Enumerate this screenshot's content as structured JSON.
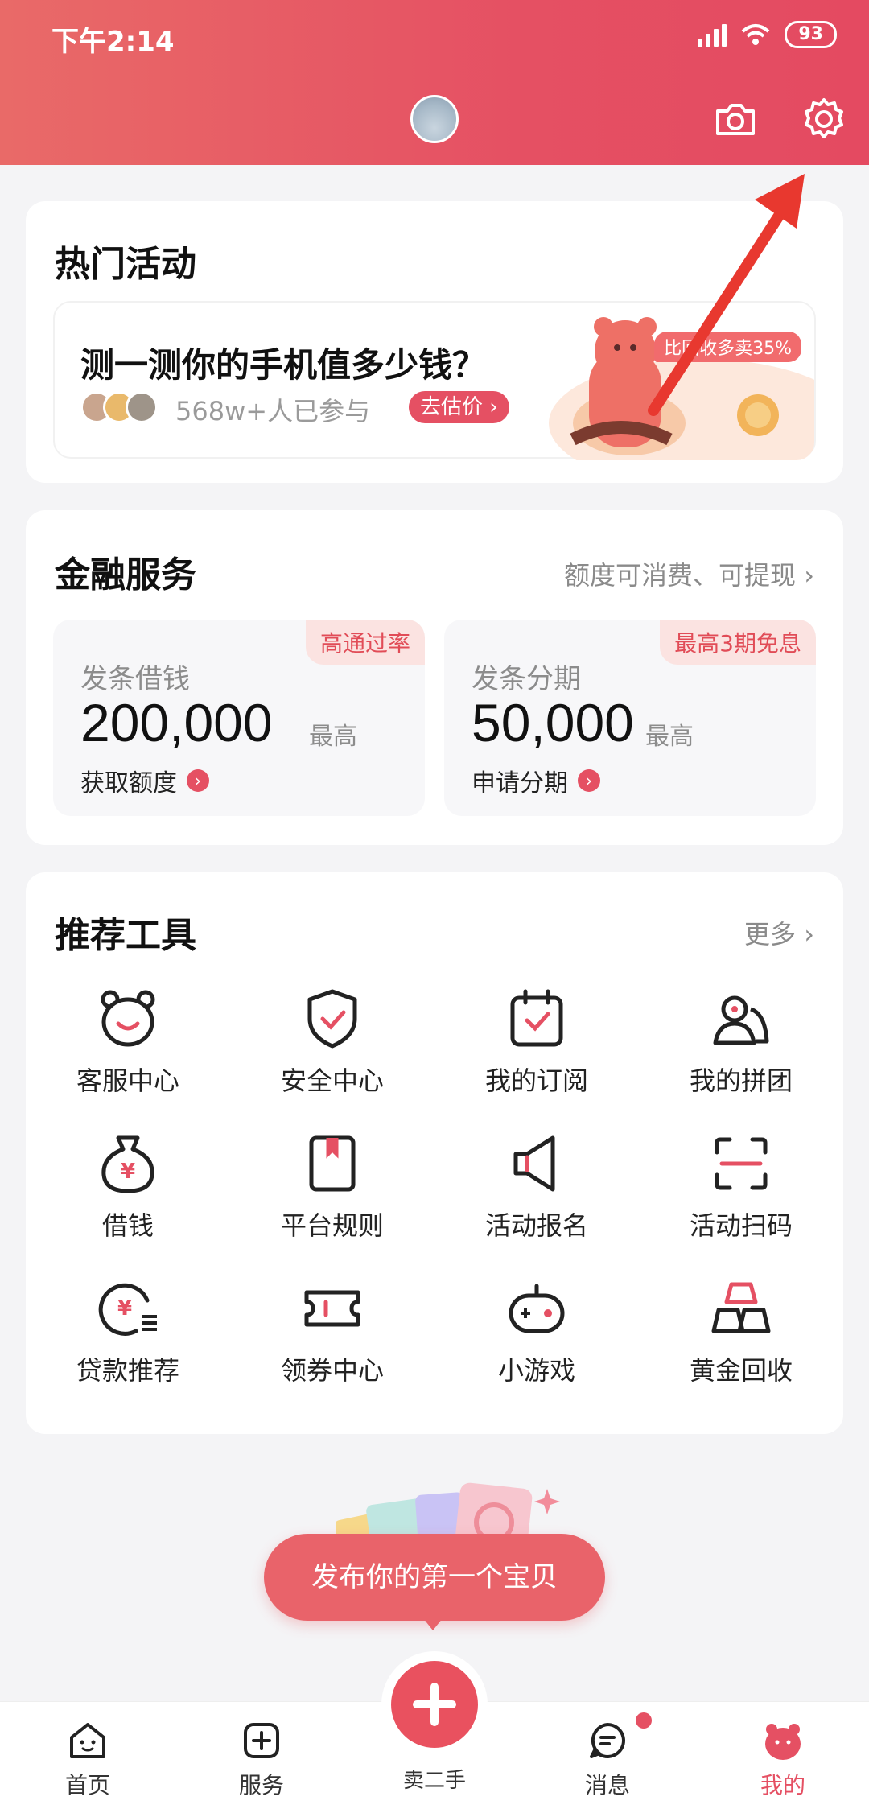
{
  "status_bar": {
    "time": "下午2:14",
    "battery": "93"
  },
  "header": {
    "camera_icon": "camera-icon",
    "settings_icon": "gear-icon"
  },
  "hot": {
    "title": "热门活动",
    "banner_title": "测一测你的手机值多少钱？",
    "participants": "568w+人已参与",
    "button": "去估价",
    "tag": "比回收多卖35%"
  },
  "finance": {
    "title": "金融服务",
    "more": "额度可消费、可提现",
    "cards": [
      {
        "badge": "高通过率",
        "label": "发条借钱",
        "amount": "200,000",
        "unit": "最高",
        "link": "获取额度"
      },
      {
        "badge": "最高3期免息",
        "label": "发条分期",
        "amount": "50,000",
        "unit": "最高",
        "link": "申请分期"
      }
    ]
  },
  "tools": {
    "title": "推荐工具",
    "more": "更多",
    "items": [
      {
        "label": "客服中心",
        "icon": "bear-face-icon"
      },
      {
        "label": "安全中心",
        "icon": "shield-icon"
      },
      {
        "label": "我的订阅",
        "icon": "calendar-icon"
      },
      {
        "label": "我的拼团",
        "icon": "group-icon"
      },
      {
        "label": "借钱",
        "icon": "money-bag-icon"
      },
      {
        "label": "平台规则",
        "icon": "rulebook-icon"
      },
      {
        "label": "活动报名",
        "icon": "megaphone-icon"
      },
      {
        "label": "活动扫码",
        "icon": "scan-icon"
      },
      {
        "label": "贷款推荐",
        "icon": "loan-icon"
      },
      {
        "label": "领券中心",
        "icon": "ticket-icon"
      },
      {
        "label": "小游戏",
        "icon": "gamepad-icon"
      },
      {
        "label": "黄金回收",
        "icon": "gold-bars-icon"
      }
    ]
  },
  "publish": {
    "label": "发布你的第一个宝贝"
  },
  "nav": {
    "home": "首页",
    "service": "服务",
    "sell": "卖二手",
    "message": "消息",
    "mine": "我的"
  },
  "colors": {
    "brand": "#e55063",
    "header_start": "#e96a68",
    "annotation_arrow": "#e8382f"
  }
}
